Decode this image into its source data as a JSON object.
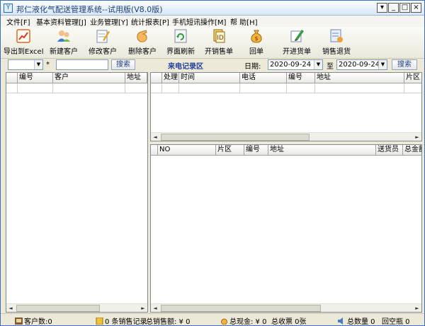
{
  "window": {
    "title": "邦仁液化气配送管理系统--试用版(V8.0版)",
    "controls": [
      "▾",
      "_",
      "□",
      "×"
    ]
  },
  "menu": [
    {
      "label": "文件[F]"
    },
    {
      "label": "基本资料管理[J]"
    },
    {
      "label": "业务管理[Y]"
    },
    {
      "label": "统计报表[P]"
    },
    {
      "label": "手机短讯操作[M]"
    },
    {
      "label": "帮 助[H]"
    }
  ],
  "toolbar": [
    {
      "label": "导出到Excel",
      "icon": "excel-chart-icon"
    },
    {
      "label": "新建客户",
      "icon": "new-customer-icon"
    },
    {
      "label": "修改客户",
      "icon": "edit-customer-icon"
    },
    {
      "label": "删除客户",
      "icon": "delete-customer-icon"
    },
    {
      "label": "界面刷新",
      "icon": "refresh-icon"
    },
    {
      "label": "开销售单",
      "icon": "sales-order-icon"
    },
    {
      "label": "回单",
      "icon": "money-bag-icon"
    },
    {
      "label": "开进货单",
      "icon": "purchase-order-icon"
    },
    {
      "label": "销售退货",
      "icon": "sales-return-icon"
    }
  ],
  "filter": {
    "asterisk": "*",
    "search_left": "搜索",
    "call_area_title": "来电记录区",
    "date_label": "日期:",
    "date_from": "2020-09-24",
    "to_label": "至",
    "date_to": "2020-09-24",
    "search_right": "搜索"
  },
  "customer_grid": {
    "headers": [
      "编号",
      "客户",
      "地址"
    ]
  },
  "call_grid": {
    "headers": [
      "处理",
      "时间",
      "电话",
      "编号",
      "地址",
      "片区"
    ]
  },
  "order_grid": {
    "headers": [
      "NO",
      "片区",
      "编号",
      "地址",
      "送货员",
      "总金额"
    ]
  },
  "status": {
    "customers": "客户数:0",
    "records": "0 条销售记录",
    "total_sales": "总销售额: ¥ 0",
    "total_cash": "总现金: ¥ 0",
    "total_tickets": "总收票 0张",
    "total_qty": "总数量 0",
    "empty_returns": "回空瓶 0"
  },
  "colors": {
    "accent": "#1c3e7a",
    "title_text": "#1c3e7a",
    "call_title": "#1f3f9a"
  }
}
